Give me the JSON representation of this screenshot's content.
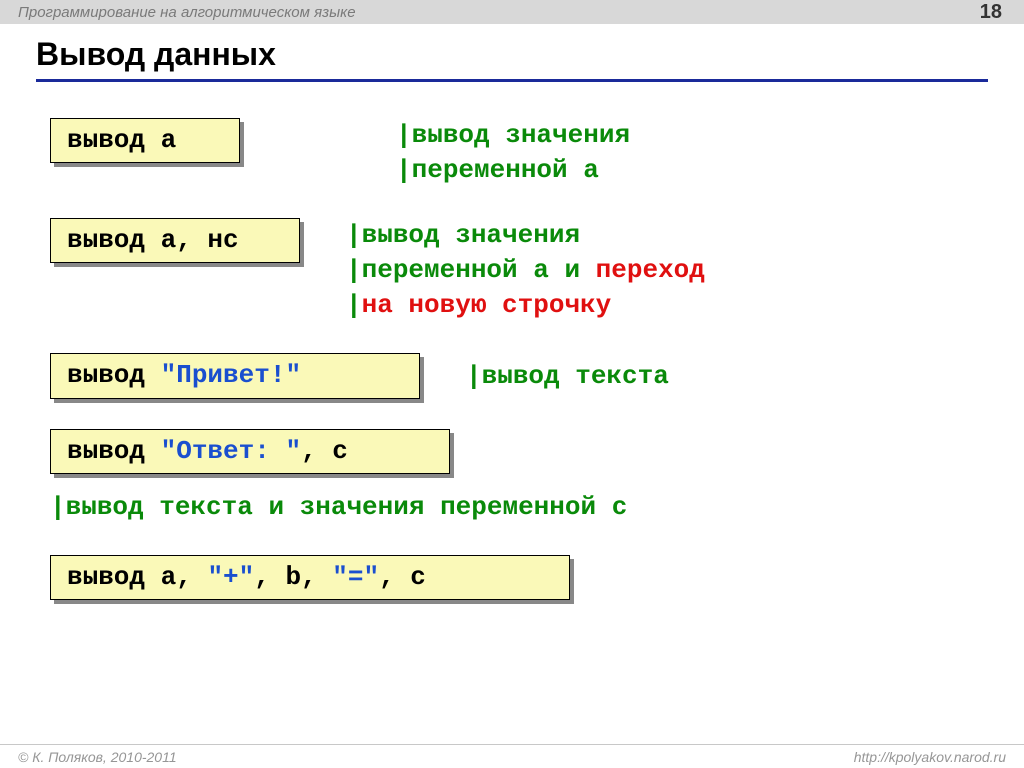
{
  "header": {
    "course_title": "Программирование на алгоритмическом языке",
    "page_number": "18"
  },
  "slide": {
    "title": "Вывод данных",
    "ex1": {
      "keyword": "вывод ",
      "arg": "a",
      "comment_l1_pipe": "|",
      "comment_l1": "вывод значения",
      "comment_l2_pipe": "|",
      "comment_l2": "переменной a"
    },
    "ex2": {
      "keyword": "вывод ",
      "arg": "a, нс",
      "comment_l1_pipe": "|",
      "comment_l1": "вывод значения",
      "comment_l2_pipe": "|",
      "comment_l2_green": "переменной a и ",
      "comment_l2_red": "переход",
      "comment_l3_pipe": "|",
      "comment_l3_red": "на новую строчку"
    },
    "ex3": {
      "keyword": "вывод ",
      "literal": "\"Привет!\"",
      "comment_pipe": "|",
      "comment": "вывод текста"
    },
    "ex4": {
      "keyword": "вывод ",
      "literal": "\"Ответ: \"",
      "rest": ", c",
      "comment_pipe": "|",
      "comment": "вывод текста и значения переменной c"
    },
    "ex5": {
      "keyword": "вывод ",
      "p1": "a, ",
      "lit1": "\"+\"",
      "p2": ", b, ",
      "lit2": "\"=\"",
      "p3": ", c"
    }
  },
  "footer": {
    "copyright": "© К. Поляков, 2010-2011",
    "url": "http://kpolyakov.narod.ru"
  }
}
